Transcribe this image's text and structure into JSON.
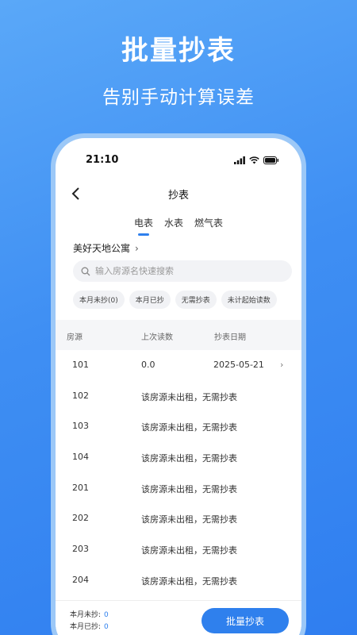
{
  "hero": {
    "title": "批量抄表",
    "subtitle": "告别手动计算误差"
  },
  "status_bar": {
    "time": "21:10"
  },
  "nav": {
    "title": "抄表"
  },
  "tabs": [
    {
      "label": "电表",
      "active": true
    },
    {
      "label": "水表",
      "active": false
    },
    {
      "label": "燃气表",
      "active": false
    }
  ],
  "building": {
    "name": "美好天地公寓"
  },
  "search": {
    "placeholder": "输入房源名快速搜索"
  },
  "filters": [
    "本月未抄(0)",
    "本月已抄",
    "无需抄表",
    "未计起始读数"
  ],
  "table": {
    "headers": [
      "房源",
      "上次读数",
      "抄表日期"
    ],
    "rows": [
      {
        "room": "101",
        "reading": "0.0",
        "date": "2025-05-21",
        "note": ""
      },
      {
        "room": "102",
        "note": "该房源未出租，无需抄表"
      },
      {
        "room": "103",
        "note": "该房源未出租，无需抄表"
      },
      {
        "room": "104",
        "note": "该房源未出租，无需抄表"
      },
      {
        "room": "201",
        "note": "该房源未出租，无需抄表"
      },
      {
        "room": "202",
        "note": "该房源未出租，无需抄表"
      },
      {
        "room": "203",
        "note": "该房源未出租，无需抄表"
      },
      {
        "room": "204",
        "note": "该房源未出租，无需抄表"
      }
    ]
  },
  "footer": {
    "unread_label": "本月未抄:",
    "unread_count": "0",
    "read_label": "本月已抄:",
    "read_count": "0",
    "batch_button": "批量抄表"
  },
  "colors": {
    "accent": "#2f80ed",
    "background": "#3f8ff3"
  }
}
